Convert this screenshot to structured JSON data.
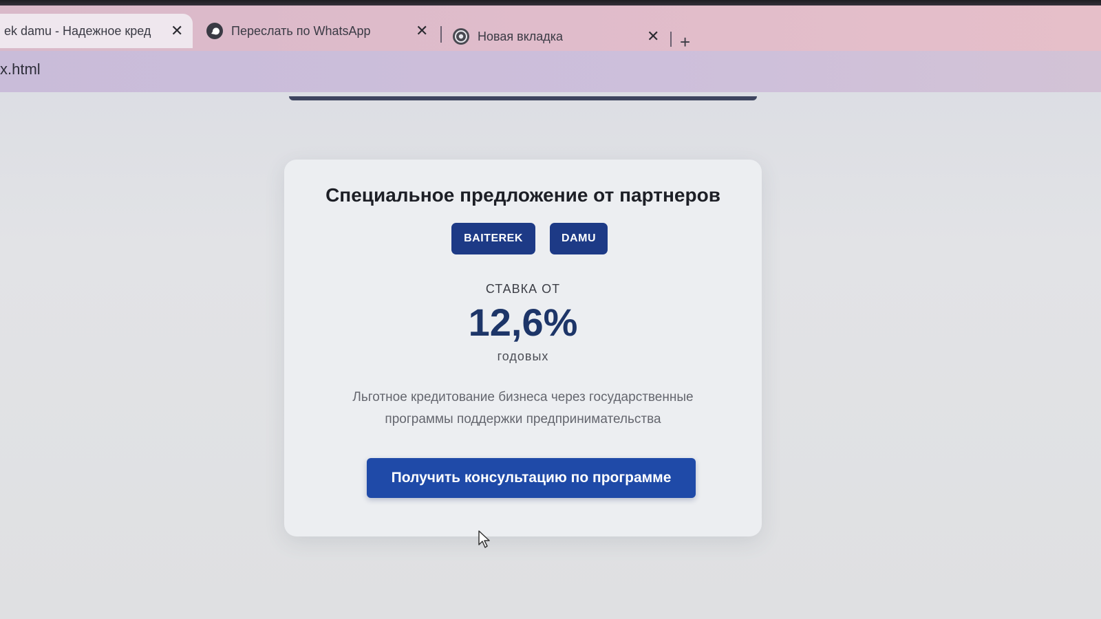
{
  "browser": {
    "tabs": [
      {
        "label": "ek damu - Надежное кред",
        "active": true,
        "icon": "none"
      },
      {
        "label": "Переслать по WhatsApp",
        "active": false,
        "icon": "whatsapp-forward-icon"
      },
      {
        "label": "Новая вкладка",
        "active": false,
        "icon": "chrome-icon"
      }
    ],
    "close_glyph": "✕",
    "new_tab_glyph": "+",
    "url": "x.html"
  },
  "offer": {
    "title": "Специальное предложение от партнеров",
    "badges": [
      "BAITEREK",
      "DAMU"
    ],
    "rate_label": "СТАВКА ОТ",
    "rate_value": "12,6%",
    "rate_unit": "годовых",
    "description": "Льготное кредитование бизнеса через государственные программы поддержки предпринимательства",
    "cta_label": "Получить консультацию по программе"
  },
  "colors": {
    "accent": "#1f4aa8",
    "badge": "#1d3a86",
    "rate_text": "#1d3568",
    "card_bg": "#eceef1"
  }
}
